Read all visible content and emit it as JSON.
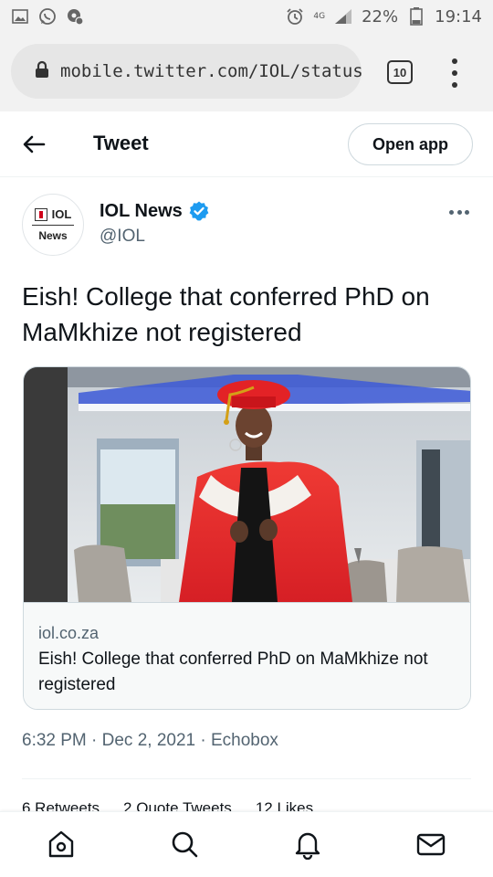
{
  "status_bar": {
    "battery": "22%",
    "time": "19:14",
    "network": "4G"
  },
  "browser": {
    "url": "mobile.twitter.com/IOL/status",
    "tab_count": "10"
  },
  "header": {
    "title": "Tweet",
    "open_app": "Open app"
  },
  "tweet": {
    "avatar_text_top": "IOL",
    "avatar_text_bottom": "News",
    "display_name": "IOL News",
    "handle": "@IOL",
    "text": "Eish! College that conferred PhD on MaMkhize not registered",
    "card": {
      "domain": "iol.co.za",
      "title": "Eish! College that conferred PhD on MaMkhize not registered"
    },
    "timestamp": "6:32 PM · Dec 2, 2021 · Echobox",
    "stats": {
      "retweets": "6 Retweets",
      "quote_tweets": "2 Quote Tweets",
      "likes": "12 Likes"
    }
  },
  "colors": {
    "verified": "#1d9bf0",
    "text_primary": "#0f1419",
    "text_secondary": "#536471",
    "gown_red": "#e8272c"
  },
  "bottom_nav": {
    "items": [
      "home-icon",
      "search-icon",
      "notifications-icon",
      "messages-icon"
    ]
  }
}
